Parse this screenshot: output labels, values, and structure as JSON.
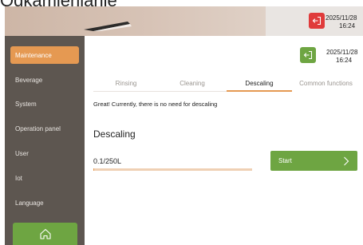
{
  "page_title": "Odkamienianie",
  "header": {
    "date": "2025/11/28",
    "time": "16:24",
    "exit_color": "#e03b3b"
  },
  "panel": {
    "date": "2025/11/28",
    "time": "16:24",
    "exit_color": "#6ea542"
  },
  "sidebar": {
    "items": [
      {
        "label": "Maintenance",
        "active": true
      },
      {
        "label": "Beverage"
      },
      {
        "label": "System"
      },
      {
        "label": "Operation panel"
      },
      {
        "label": "User"
      },
      {
        "label": "Iot"
      },
      {
        "label": "Language"
      }
    ],
    "home_icon": "home-icon"
  },
  "tabs": [
    {
      "label": "Rinsing"
    },
    {
      "label": "Cleaning"
    },
    {
      "label": "Descaling",
      "active": true
    },
    {
      "label": "Common functions"
    }
  ],
  "main": {
    "notice": "Great! Currently, there is no need for descaling",
    "section_title": "Descaling",
    "progress_text": "0.1/250L",
    "progress_fraction": 0.0004,
    "start_label": "Start"
  },
  "colors": {
    "accent": "#e59952",
    "green": "#6ea542",
    "sidebar": "#5d5650"
  }
}
